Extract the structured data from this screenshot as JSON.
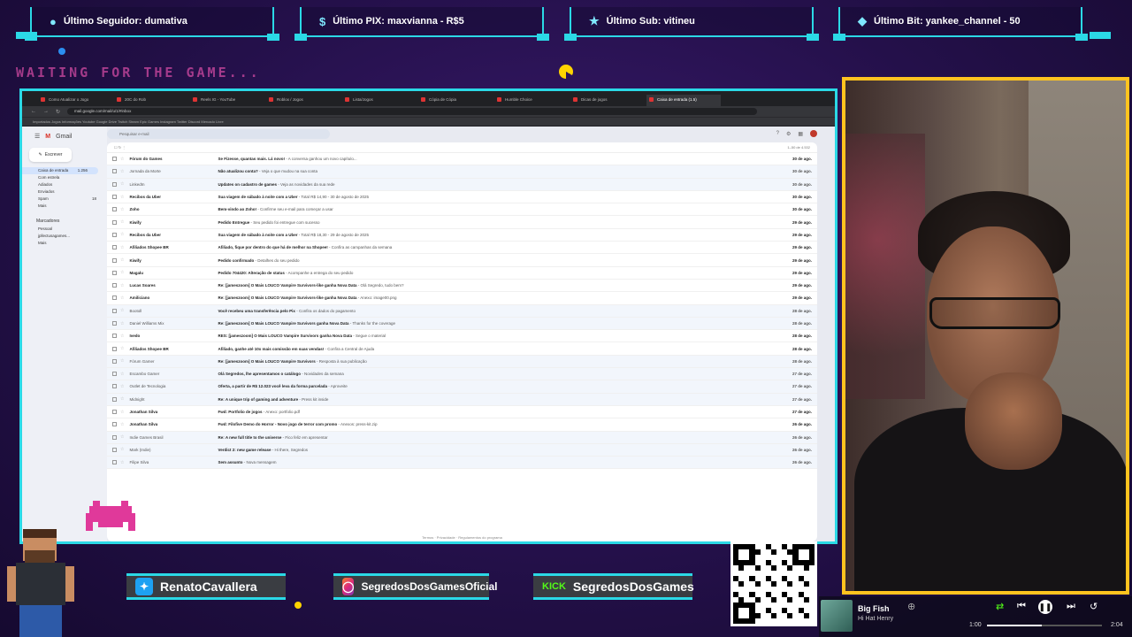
{
  "alerts": [
    {
      "icon": "user-icon",
      "text": "Último Seguidor: dumativa"
    },
    {
      "icon": "dollar-icon",
      "text": "Último PIX: maxvianna - R$5"
    },
    {
      "icon": "star-icon",
      "text": "Último Sub: vitineu"
    },
    {
      "icon": "diamond-icon",
      "text": "Último Bit: yankee_channel - 50"
    }
  ],
  "overlay": {
    "waiting_text": "WAITING FOR THE GAME..."
  },
  "browser": {
    "url": "mail.google.com/mail/u/1/#inbox",
    "tabs": [
      "Como Atualizar o Jogo",
      "20C do Rob",
      "Reels IG - YouTube",
      "Roblox / Jogos",
      "Lista/Jogos",
      "Cópia de Cópia",
      "Humble Choice",
      "Dicas de jogos",
      "Caixa de entrada (1.5)"
    ],
    "bookmarks": "Importados   Jogos   Informações   Youtube   Google Drive   Twitch   Steam   Epic Games   Instagram   Twitter   Discord   Mercado Livre"
  },
  "gmail": {
    "app_name": "Gmail",
    "compose_label": "Escrever",
    "search_placeholder": "Pesquisar e-mail",
    "nav": [
      {
        "label": "Caixa de entrada",
        "count": "1.256"
      },
      {
        "label": "Com estrela",
        "count": ""
      },
      {
        "label": "Adiados",
        "count": ""
      },
      {
        "label": "Enviados",
        "count": ""
      },
      {
        "label": "Spam",
        "count": "18"
      },
      {
        "label": "Mais",
        "count": ""
      }
    ],
    "labels_title": "Marcadores",
    "labels": [
      "Pessoal",
      "jpllectusagames...",
      "Mais"
    ],
    "toolbar_range": "1–50 de 4.532",
    "emails": [
      {
        "sender": "Fórum do Games",
        "subject": "Se Fizesse, quantas mais. Lá novo!",
        "snippet": " - A conversa ganhou um novo capítulo...",
        "date": "30 de ago.",
        "read": false
      },
      {
        "sender": "Jornada da Morte",
        "subject": "Não atualizou conta?",
        "snippet": " - Veja o que mudou na sua conta",
        "date": "30 de ago.",
        "read": true
      },
      {
        "sender": "LinkedIn",
        "subject": "Updates on cadastro de games",
        "snippet": " - Veja as novidades da sua rede",
        "date": "30 de ago.",
        "read": true
      },
      {
        "sender": "Recibos da Uber",
        "subject": "Sua viagem de sábado à noite com a Uber",
        "snippet": " - Total R$ 14,90 - 30 de agosto de 2025",
        "date": "30 de ago.",
        "read": false
      },
      {
        "sender": "Zoho",
        "subject": "Bem-vindo ao Zoho!",
        "snippet": " - Confirme seu e-mail para começar a usar",
        "date": "30 de ago.",
        "read": false
      },
      {
        "sender": "Kiwify",
        "subject": "Pedido Entregue",
        "snippet": " - Seu pedido foi entregue com sucesso",
        "date": "29 de ago.",
        "read": false
      },
      {
        "sender": "Recibos da Uber",
        "subject": "Sua viagem de sábado à noite com a Uber",
        "snippet": " - Total R$ 18,30 - 29 de agosto de 2025",
        "date": "29 de ago.",
        "read": false
      },
      {
        "sender": "Afiliados Shopee BR",
        "subject": "Afiliado, fique por dentro do que há de melhor na Shopee!",
        "snippet": " - Confira as campanhas da semana",
        "date": "29 de ago.",
        "read": false
      },
      {
        "sender": "Kiwify",
        "subject": "Pedido confirmado",
        "snippet": " - Detalhes do seu pedido",
        "date": "29 de ago.",
        "read": false
      },
      {
        "sender": "Magalu",
        "subject": "Pedido 704420: Alteração de status",
        "snippet": " - Acompanhe a entrega do seu pedido",
        "date": "29 de ago.",
        "read": false
      },
      {
        "sender": "Lucas Soares",
        "subject": "Re: [jameszoom] O Mais LOUCO Vampire Survivors-like ganha Nova Data",
        "snippet": " - Olá Segredo, tudo bem?",
        "date": "29 de ago.",
        "read": false
      },
      {
        "sender": "Amiliciano",
        "subject": "Re: [jameszoom] O Mais LOUCO Vampire Survivors-like ganha Nova Data",
        "snippet": " - Anexo: image00.png",
        "date": "29 de ago.",
        "read": false
      },
      {
        "sender": "Bootoll",
        "subject": "Você recebeu uma transferência pelo Pix",
        "snippet": " - Confira os dados do pagamento",
        "date": "28 de ago.",
        "read": true
      },
      {
        "sender": "Daniel Williams Mix",
        "subject": "Re: [jameszoom] O Mais LOUCO Vampire Survivors ganha Nova Data",
        "snippet": " - Thanks for the coverage",
        "date": "28 de ago.",
        "read": true
      },
      {
        "sender": "Ivedo",
        "subject": "RES: [jameszoom] O Mais LOUCO Vampire Survivors ganha Nova Data",
        "snippet": " - Segue o material",
        "date": "28 de ago.",
        "read": false
      },
      {
        "sender": "Afiliados Shopee BR",
        "subject": "Afiliado, ganhe até 10x mais comissão em suas vendas!",
        "snippet": " - Confira a Central de Ajuda",
        "date": "28 de ago.",
        "read": false
      },
      {
        "sender": "Fórum Gamer",
        "subject": "Re: [jameszoom] O Mais LOUCO Vampire Survivors",
        "snippet": " - Resposta à sua publicação",
        "date": "28 de ago.",
        "read": true
      },
      {
        "sender": "Escambo Gamer",
        "subject": "Olá Segredos, lhe apresentamos o catálogo",
        "snippet": " - Novidades da semana",
        "date": "27 de ago.",
        "read": true
      },
      {
        "sender": "Outlet de Tecnologia",
        "subject": "Oferta, a partir de R$ 12.023 você leva da forma parcelada",
        "snippet": " - Aproveite",
        "date": "27 de ago.",
        "read": true
      },
      {
        "sender": "Midnight",
        "subject": "Re: A unique trip of gaming and adventure",
        "snippet": " - Press kit inside",
        "date": "27 de ago.",
        "read": true
      },
      {
        "sender": "Jonathan Silva",
        "subject": "Fwd: Portfolio de jogos",
        "snippet": " - Anexo: portfolio.pdf",
        "date": "27 de ago.",
        "read": false
      },
      {
        "sender": "Jonathan Silva",
        "subject": "Fwd: Filofive Demo do Horror - Novo jogo de terror com promo",
        "snippet": " - Anexos: press-kit.zip",
        "date": "26 de ago.",
        "read": false
      },
      {
        "sender": "Indie Games Brasil",
        "subject": "Re: A new full title to the universe",
        "snippet": " - Fico feliz em apresentar",
        "date": "26 de ago.",
        "read": true
      },
      {
        "sender": "Mark (Indie)",
        "subject": "Verdict 2: new game release",
        "snippet": " - Hi there, Segredos",
        "date": "26 de ago.",
        "read": true
      },
      {
        "sender": "Filipe Silva",
        "subject": "Sem assunto",
        "snippet": " - Nova mensagem",
        "date": "26 de ago.",
        "read": true
      }
    ],
    "footer": "Termos · Privacidade · Regulamentos do programa"
  },
  "socials": [
    {
      "platform": "twitter",
      "icon": "twitter-icon",
      "handle": "RenatoCavallera",
      "color": "#1da1f2"
    },
    {
      "platform": "instagram",
      "icon": "instagram-icon",
      "handle": "SegredosDosGamesOficial",
      "color": "#e1306c"
    },
    {
      "platform": "kick",
      "icon": "kick-icon",
      "handle": "SegredosDosGames",
      "color": "#53fc18",
      "badge": "KICK"
    }
  ],
  "qr": {
    "url": "livepix.gg/segredosdosgames"
  },
  "player": {
    "track": "Big Fish",
    "artist": "Hi Hat Henry",
    "time_current": "1:00",
    "time_total": "2:04",
    "progress": 0.48
  },
  "colors": {
    "accent": "#2bd9e6",
    "cam_border": "#ffc31f",
    "pink": "#e0399a"
  }
}
